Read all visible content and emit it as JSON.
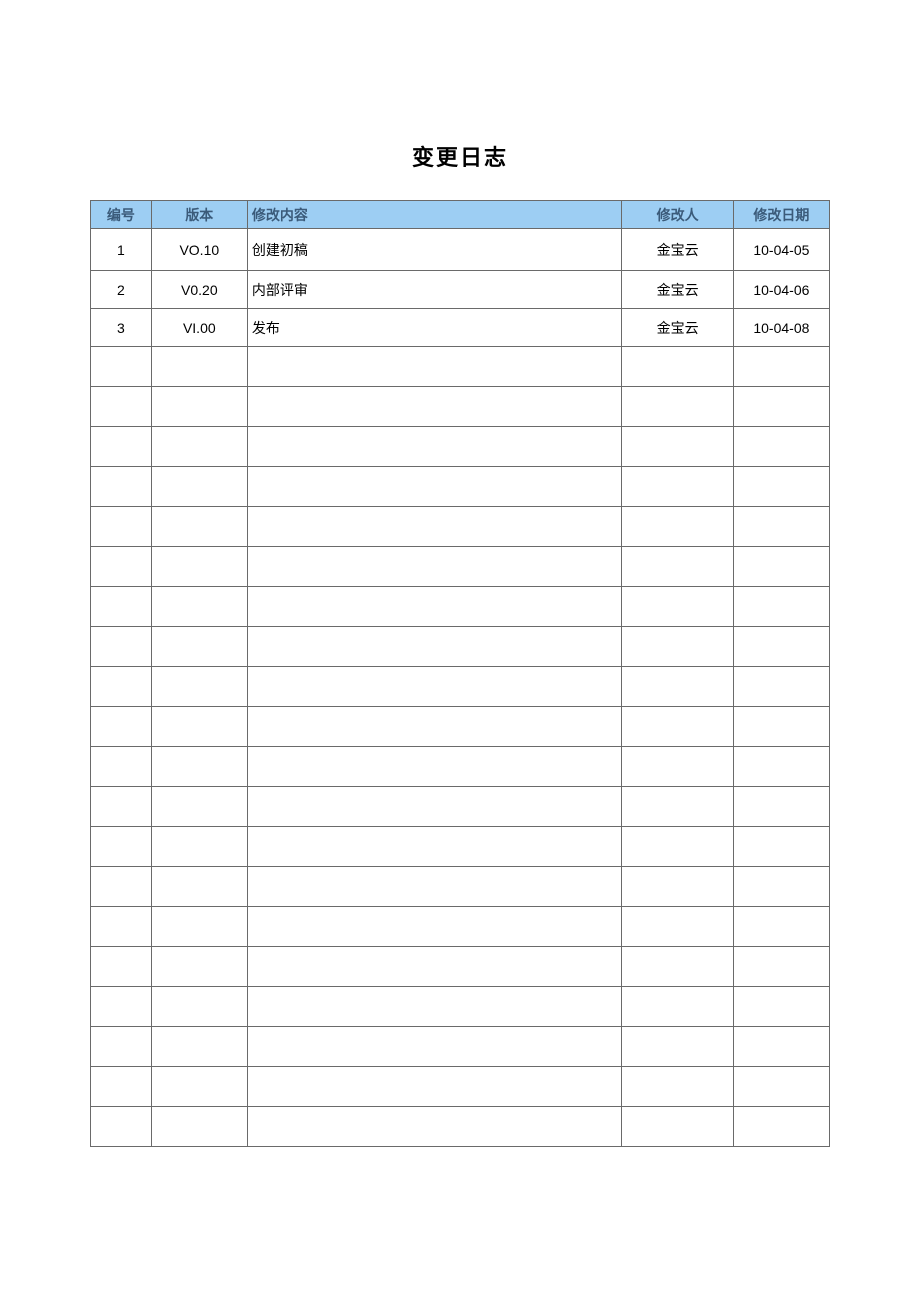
{
  "title": "变更日志",
  "columns": {
    "id": "编号",
    "version": "版本",
    "content": "修改内容",
    "author": "修改人",
    "date": "修改日期"
  },
  "rows": [
    {
      "id": "1",
      "version": "VO.10",
      "content": "创建初稿",
      "author": "金宝云",
      "date": "10-04-05"
    },
    {
      "id": "2",
      "version": "V0.20",
      "content": "内部评审",
      "author": "金宝云",
      "date": "10-04-06"
    },
    {
      "id": "3",
      "version": "VI.00",
      "content": "发布",
      "author": "金宝云",
      "date": "10-04-08"
    },
    {
      "id": "",
      "version": "",
      "content": "",
      "author": "",
      "date": ""
    },
    {
      "id": "",
      "version": "",
      "content": "",
      "author": "",
      "date": ""
    },
    {
      "id": "",
      "version": "",
      "content": "",
      "author": "",
      "date": ""
    },
    {
      "id": "",
      "version": "",
      "content": "",
      "author": "",
      "date": ""
    },
    {
      "id": "",
      "version": "",
      "content": "",
      "author": "",
      "date": ""
    },
    {
      "id": "",
      "version": "",
      "content": "",
      "author": "",
      "date": ""
    },
    {
      "id": "",
      "version": "",
      "content": "",
      "author": "",
      "date": ""
    },
    {
      "id": "",
      "version": "",
      "content": "",
      "author": "",
      "date": ""
    },
    {
      "id": "",
      "version": "",
      "content": "",
      "author": "",
      "date": ""
    },
    {
      "id": "",
      "version": "",
      "content": "",
      "author": "",
      "date": ""
    },
    {
      "id": "",
      "version": "",
      "content": "",
      "author": "",
      "date": ""
    },
    {
      "id": "",
      "version": "",
      "content": "",
      "author": "",
      "date": ""
    },
    {
      "id": "",
      "version": "",
      "content": "",
      "author": "",
      "date": ""
    },
    {
      "id": "",
      "version": "",
      "content": "",
      "author": "",
      "date": ""
    },
    {
      "id": "",
      "version": "",
      "content": "",
      "author": "",
      "date": ""
    },
    {
      "id": "",
      "version": "",
      "content": "",
      "author": "",
      "date": ""
    },
    {
      "id": "",
      "version": "",
      "content": "",
      "author": "",
      "date": ""
    },
    {
      "id": "",
      "version": "",
      "content": "",
      "author": "",
      "date": ""
    },
    {
      "id": "",
      "version": "",
      "content": "",
      "author": "",
      "date": ""
    },
    {
      "id": "",
      "version": "",
      "content": "",
      "author": "",
      "date": ""
    }
  ]
}
